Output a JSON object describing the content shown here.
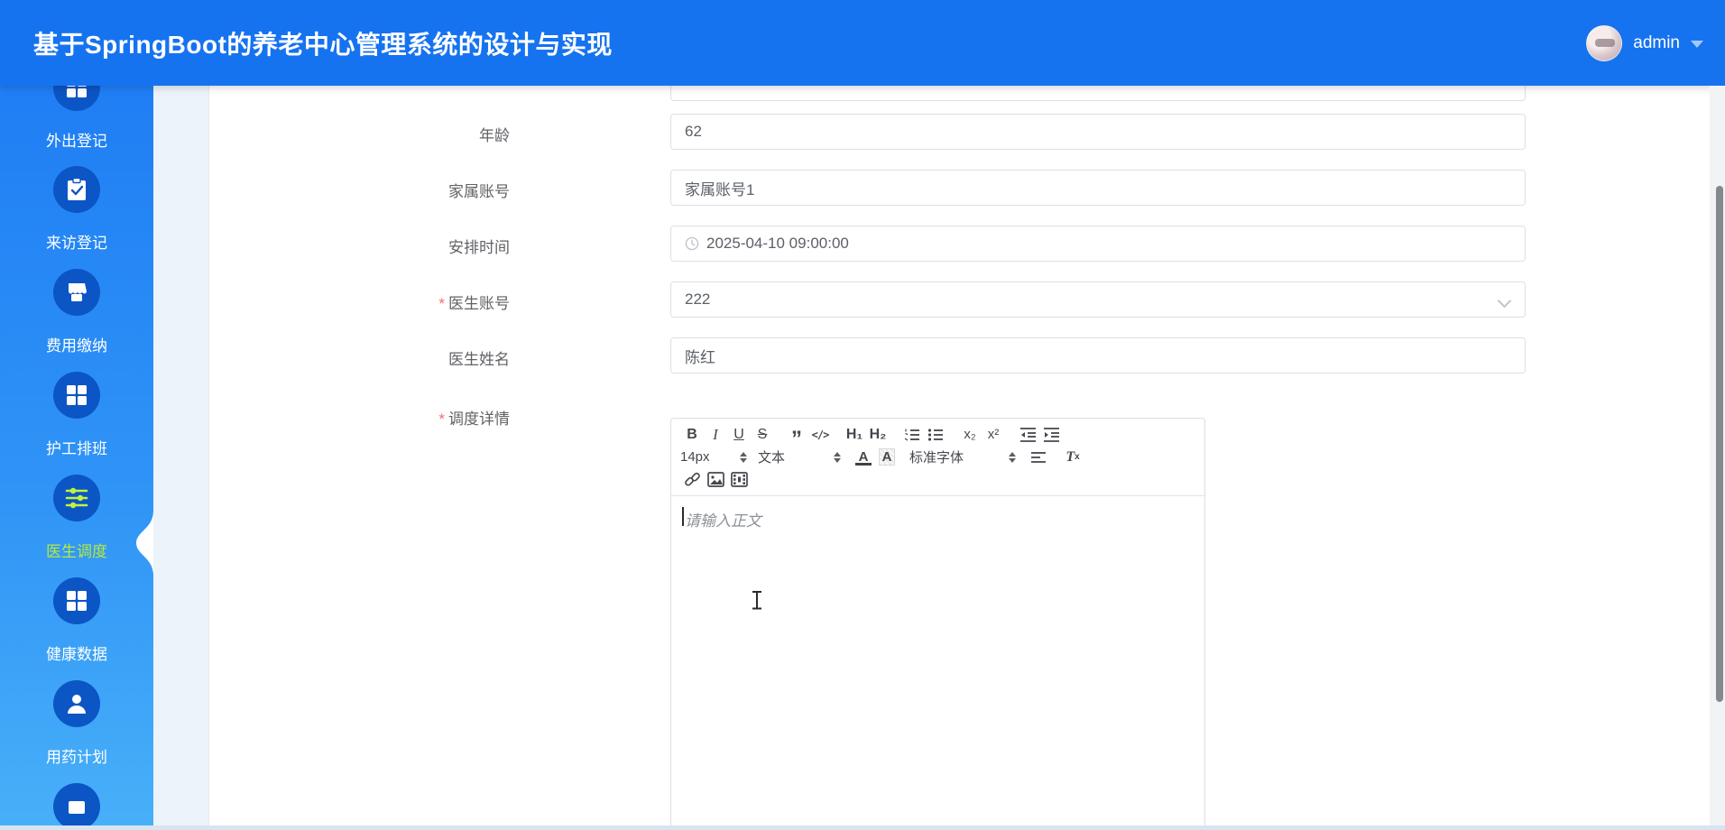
{
  "header": {
    "title": "基于SpringBoot的养老中心管理系统的设计与实现",
    "username": "admin"
  },
  "sidebar": {
    "items": [
      {
        "label": "外出登记",
        "icon": "grid-icon",
        "active": false
      },
      {
        "label": "来访登记",
        "icon": "clipboard-check-icon",
        "active": false
      },
      {
        "label": "费用缴纳",
        "icon": "wallet-icon",
        "active": false
      },
      {
        "label": "护工排班",
        "icon": "grid-icon",
        "active": false
      },
      {
        "label": "医生调度",
        "icon": "sliders-icon",
        "active": true
      },
      {
        "label": "健康数据",
        "icon": "grid-icon",
        "active": false
      },
      {
        "label": "用药计划",
        "icon": "user-icon",
        "active": false
      }
    ],
    "active_color": "#b7e93b"
  },
  "form": {
    "required_mark": "*",
    "fields": [
      {
        "label": "年龄",
        "value": "62",
        "required": false,
        "type": "input"
      },
      {
        "label": "家属账号",
        "value": "家属账号1",
        "required": false,
        "type": "input"
      },
      {
        "label": "安排时间",
        "value": "2025-04-10 09:00:00",
        "required": false,
        "type": "datetime",
        "icon": "clock-icon"
      },
      {
        "label": "医生账号",
        "value": "222",
        "required": true,
        "type": "select"
      },
      {
        "label": "医生姓名",
        "value": "陈红",
        "required": false,
        "type": "input"
      },
      {
        "label": "调度详情",
        "value": "",
        "required": true,
        "type": "rich-text-editor"
      }
    ]
  },
  "editor": {
    "placeholder": "请输入正文",
    "toolbar": {
      "bold": "B",
      "italic": "I",
      "underline": "U",
      "strike": "S",
      "quote": "”",
      "code": "</>",
      "h1": "H₁",
      "h2": "H₂",
      "sub": "x₂",
      "sup": "x²",
      "size": "14px",
      "style": "文本",
      "color": "A",
      "background": "A",
      "font": "标准字体",
      "clean": "Tx"
    }
  },
  "colors": {
    "header_blue": "#1673f0",
    "sidebar_top": "#1f7ef4",
    "sidebar_bottom": "#48b0f9",
    "icon_circle": "#0c55c5",
    "active_green": "#b7e93b",
    "required_red": "#f56c6c"
  }
}
